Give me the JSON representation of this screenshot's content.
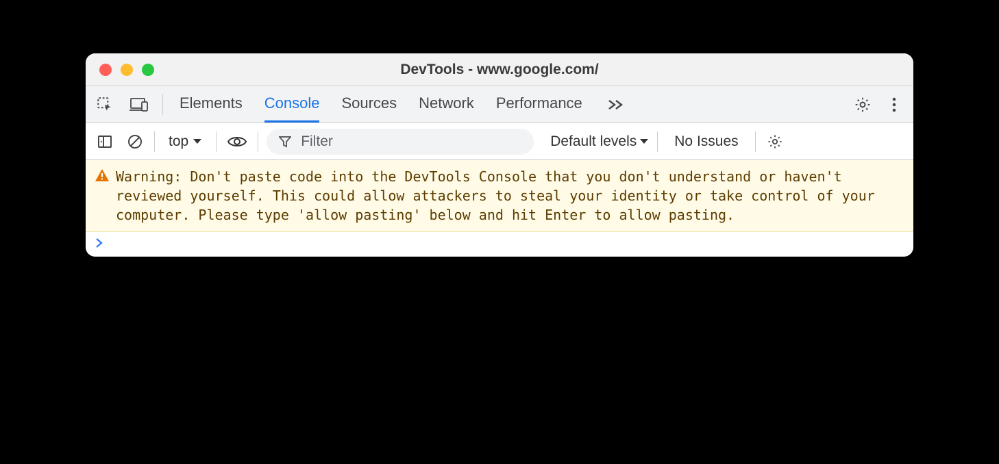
{
  "window": {
    "title": "DevTools - www.google.com/"
  },
  "tabs": {
    "items": [
      "Elements",
      "Console",
      "Sources",
      "Network",
      "Performance"
    ],
    "active_index": 1
  },
  "console_toolbar": {
    "context": "top",
    "filter_placeholder": "Filter",
    "levels_label": "Default levels",
    "issues_label": "No Issues"
  },
  "warning": {
    "text": "Warning: Don't paste code into the DevTools Console that you don't understand or haven't reviewed yourself. This could allow attackers to steal your identity or take control of your computer. Please type 'allow pasting' below and hit Enter to allow pasting."
  }
}
